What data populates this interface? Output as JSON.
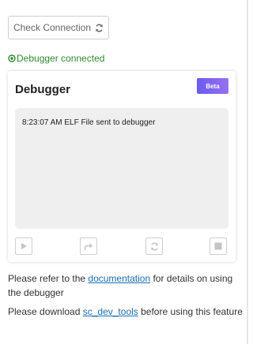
{
  "check_button": {
    "label": "Check Connection",
    "icon": "refresh-icon"
  },
  "status": {
    "icon": "check-circle-icon",
    "text": "Debugger connected",
    "color": "#2e8b2e"
  },
  "panel": {
    "title": "Debugger",
    "badge": "Beta",
    "log_lines": [
      "8:23:07 AM ELF File sent to debugger"
    ],
    "controls": [
      {
        "name": "play",
        "icon": "play-icon"
      },
      {
        "name": "step",
        "icon": "step-over-icon"
      },
      {
        "name": "restart",
        "icon": "refresh-icon"
      },
      {
        "name": "stop",
        "icon": "stop-icon"
      }
    ]
  },
  "notes": {
    "doc_prefix": "Please refer to the ",
    "doc_link": "documentation",
    "doc_suffix": " for details on using the debugger",
    "dl_prefix": "Please download ",
    "dl_link": "sc_dev_tools",
    "dl_suffix": " before using this feature"
  },
  "colors": {
    "link": "#1a6fb5",
    "badge_start": "#6a5cf0",
    "badge_end": "#9a6ff0"
  }
}
